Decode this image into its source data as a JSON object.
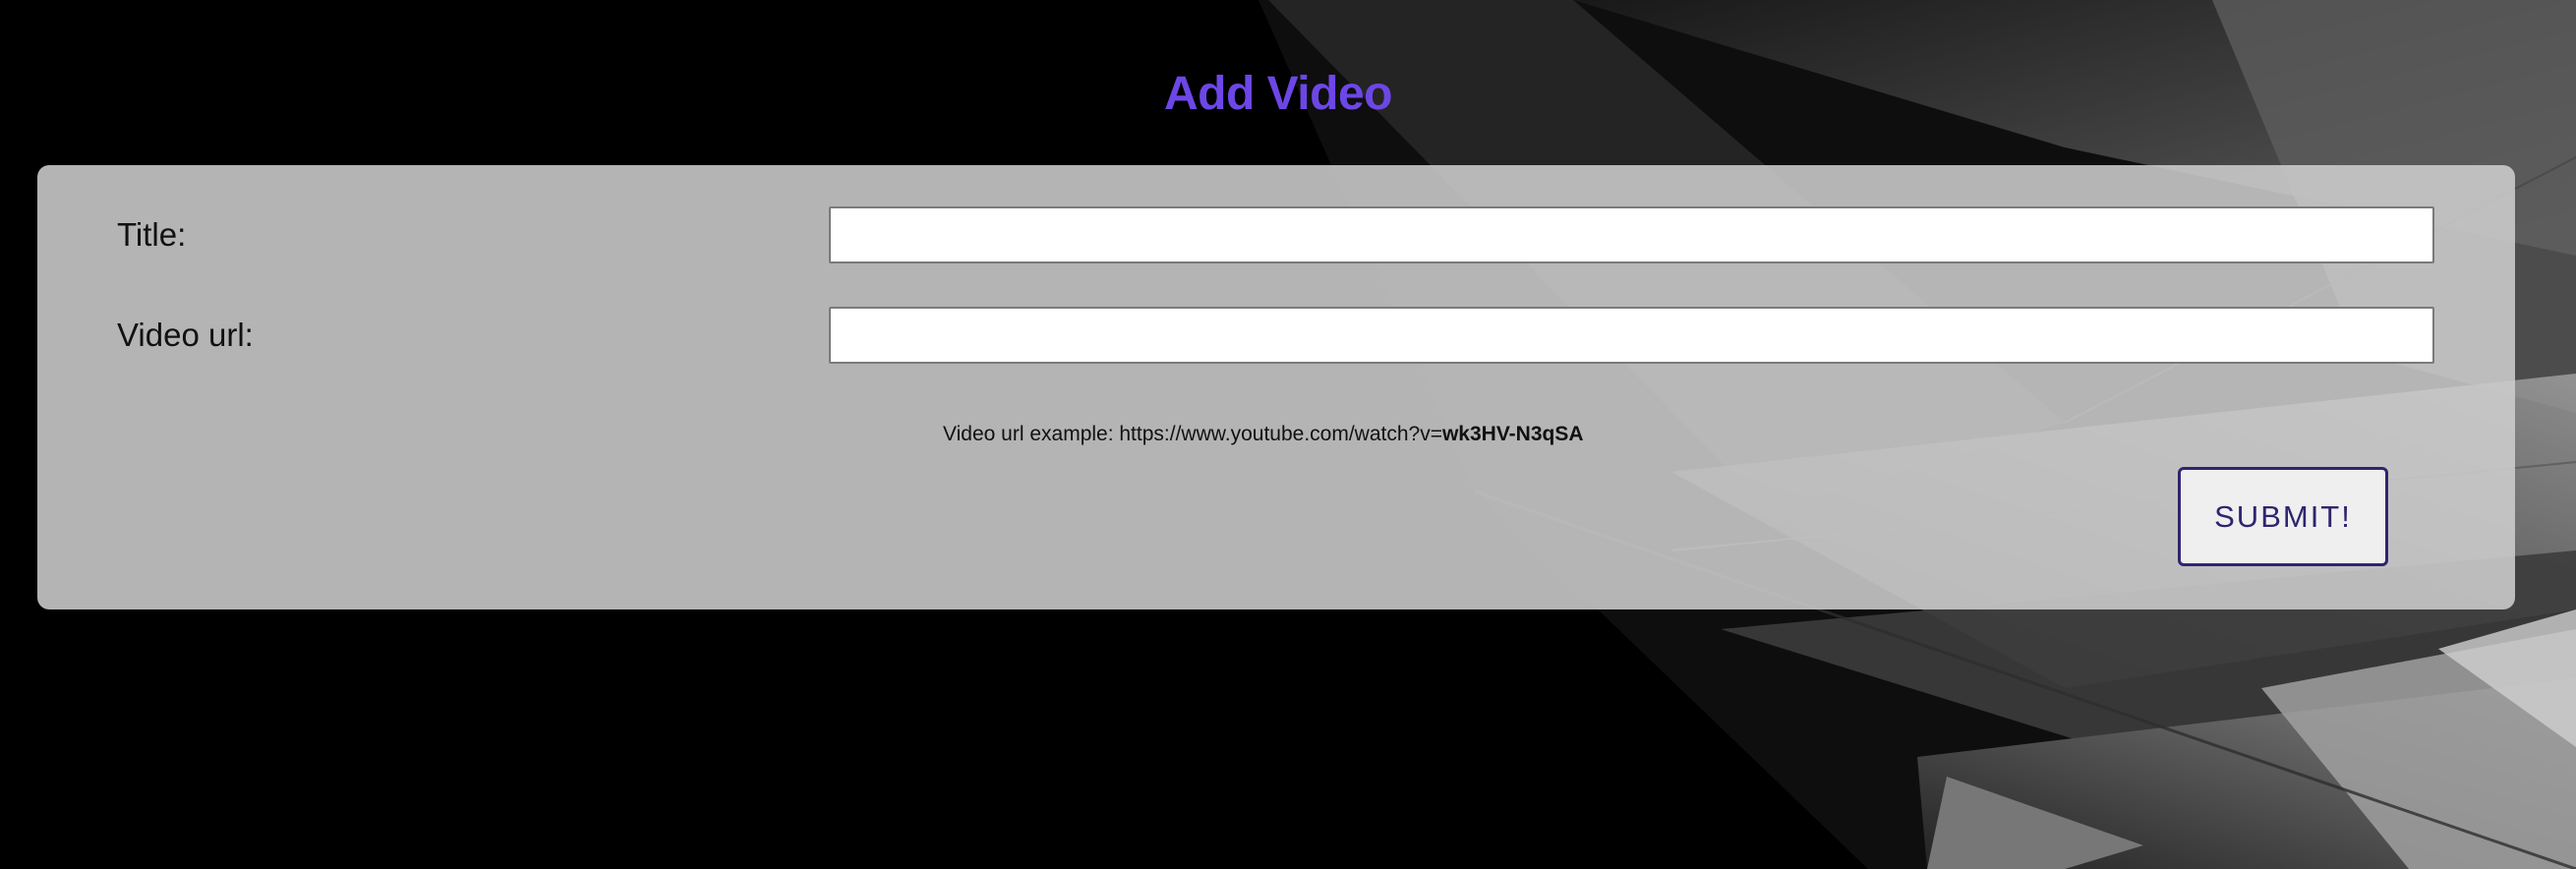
{
  "page": {
    "title": "Add Video"
  },
  "form": {
    "title_label": "Title:",
    "title_value": "",
    "url_label": "Video url:",
    "url_value": "",
    "hint_prefix": "Video url example: https://www.youtube.com/watch?v=",
    "hint_id": "wk3HV-N3qSA",
    "submit_label": "SUBMIT!"
  },
  "colors": {
    "title": "#6c47e6",
    "panel": "#cdcdcd",
    "button_border": "#2e2570",
    "background": "#000000"
  }
}
